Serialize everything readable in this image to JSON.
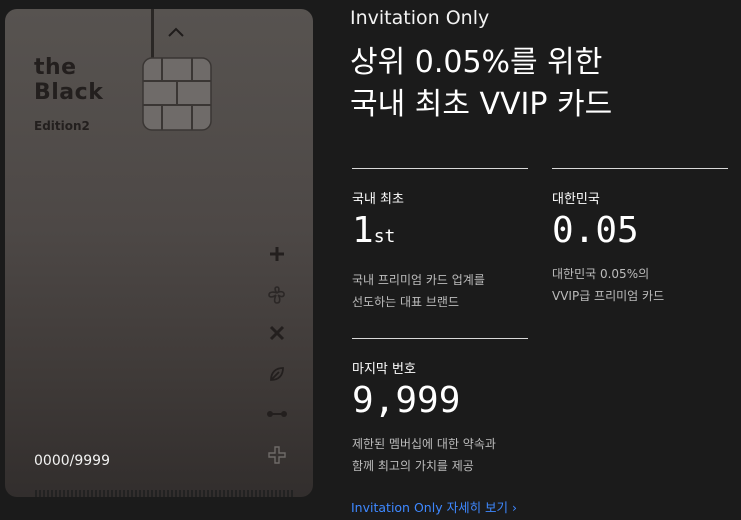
{
  "card": {
    "brand_line1": "the",
    "brand_line2": "Black",
    "edition": "Edition2",
    "number": "0000/9999",
    "icons": [
      "plus-icon",
      "flower-icon",
      "cross-icon",
      "leaf-icon",
      "dumbbell-icon",
      "plus-outline-icon"
    ]
  },
  "eyebrow": "Invitation Only",
  "headline": {
    "line1": "상위 0.05%를 위한",
    "line2": "국내 최초 VVIP 카드"
  },
  "stats": [
    {
      "label": "국내 최초",
      "value": "1",
      "suffix": "st",
      "desc1": "국내 프리미엄 카드 업계를",
      "desc2": "선도하는 대표 브랜드"
    },
    {
      "label": "대한민국",
      "value": "0.05",
      "suffix": "",
      "desc1": "대한민국 0.05%의",
      "desc2": "VVIP급 프리미엄 카드"
    },
    {
      "label": "마지막 번호",
      "value": "9,999",
      "suffix": "",
      "desc1": "제한된 멤버십에 대한 약속과",
      "desc2": "함께 최고의 가치를 제공"
    }
  ],
  "link_label": "Invitation Only 자세히 보기 ›",
  "colors": {
    "accent": "#3e88ff",
    "background": "#1b1b1b"
  }
}
